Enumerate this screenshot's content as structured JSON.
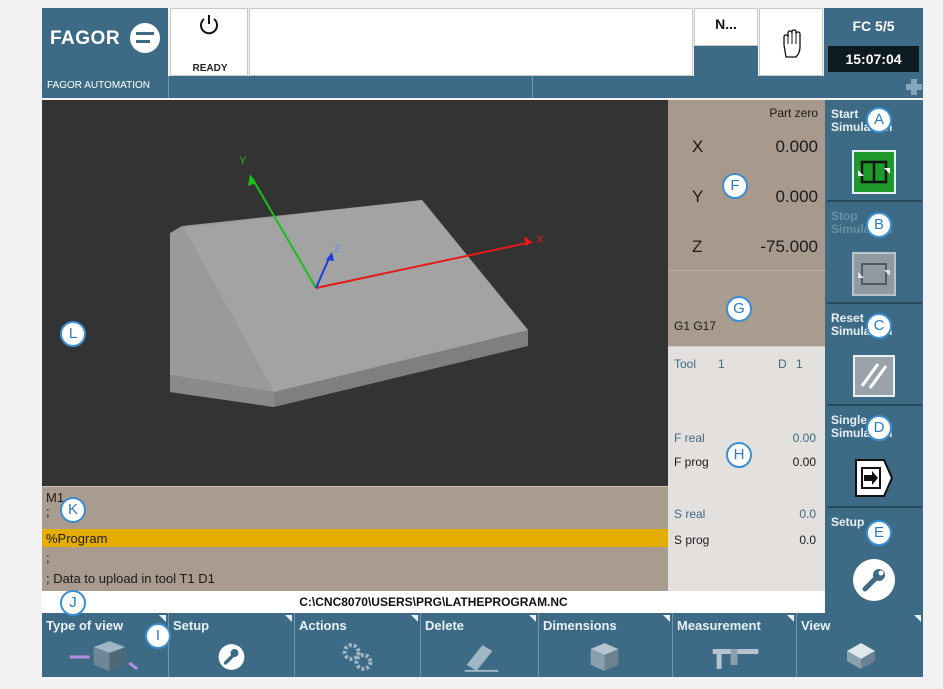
{
  "header": {
    "logo_text": "FAGOR",
    "company": "FAGOR AUTOMATION",
    "status": "READY",
    "mode_short": "N...",
    "channel": "FC 5/5",
    "time": "15:07:04"
  },
  "view": {
    "axis_x": "X",
    "axis_y": "Y",
    "axis_z": "Z"
  },
  "program": {
    "lines": [
      "M1",
      ";",
      "%Program",
      ";",
      "; Data to upload in tool T1 D1"
    ],
    "highlighted_index": 2,
    "highlight_color": "#e5ad00"
  },
  "file_path": "C:\\CNC8070\\USERS\\PRG\\LATHEPROGRAM.NC",
  "coordinates": {
    "reference": "Part zero",
    "axes": [
      {
        "name": "X",
        "value": "0.000"
      },
      {
        "name": "Y",
        "value": "0.000"
      },
      {
        "name": "Z",
        "value": "-75.000"
      }
    ]
  },
  "g_functions": "G1 G17",
  "tool_info": {
    "tool_label": "Tool",
    "tool_value": "1",
    "d_label": "D",
    "d_value": "1",
    "f_real_label": "F real",
    "f_real_value": "0.00",
    "f_prog_label": "F prog",
    "f_prog_value": "0.00",
    "s_real_label": "S real",
    "s_real_value": "0.0",
    "s_prog_label": "S prog",
    "s_prog_value": "0.0"
  },
  "right_softkeys": [
    {
      "line1": "Start",
      "line2": "Simulation",
      "icon": "start-simulation-icon",
      "enabled": true
    },
    {
      "line1": "Stop",
      "line2": "Simulation",
      "icon": "stop-simulation-icon",
      "enabled": false
    },
    {
      "line1": "Reset",
      "line2": "Simulation",
      "icon": "reset-simulation-icon",
      "enabled": true
    },
    {
      "line1": "Single...",
      "line2": "Simulation",
      "icon": "single-block-icon",
      "enabled": true
    },
    {
      "line1": "Setup",
      "line2": "",
      "icon": "wrench-icon",
      "enabled": true
    }
  ],
  "bottom_softkeys": [
    {
      "label": "Type of view",
      "icon": "cube-view-icon"
    },
    {
      "label": "Setup",
      "icon": "wrench-icon"
    },
    {
      "label": "Actions",
      "icon": "gears-icon"
    },
    {
      "label": "Delete",
      "icon": "eraser-icon"
    },
    {
      "label": "Dimensions",
      "icon": "cube-icon"
    },
    {
      "label": "Measurement",
      "icon": "caliper-icon"
    },
    {
      "label": "View",
      "icon": "plane-view-icon"
    }
  ],
  "callouts": [
    "A",
    "B",
    "C",
    "D",
    "E",
    "F",
    "G",
    "H",
    "I",
    "J",
    "K",
    "L"
  ],
  "colors": {
    "panel_blue": "#3d6b85",
    "workpiece": "#9a9a9a",
    "axis_x": "#e31b1b",
    "axis_y": "#19c019",
    "axis_z": "#1d3fd6",
    "start_green": "#1e9a2c"
  }
}
